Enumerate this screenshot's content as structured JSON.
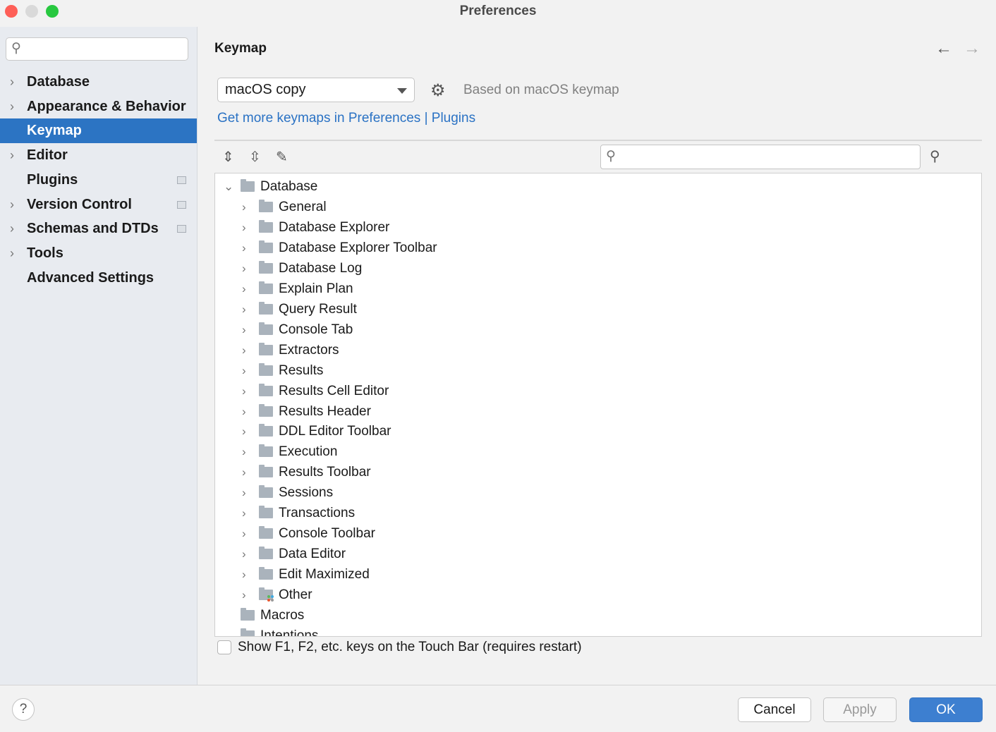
{
  "window": {
    "title": "Preferences"
  },
  "sidebar": {
    "search_placeholder": "",
    "items": [
      {
        "label": "Database",
        "expandable": true
      },
      {
        "label": "Appearance & Behavior",
        "expandable": true
      },
      {
        "label": "Keymap",
        "expandable": false,
        "selected": true
      },
      {
        "label": "Editor",
        "expandable": true
      },
      {
        "label": "Plugins",
        "expandable": false,
        "badge": true
      },
      {
        "label": "Version Control",
        "expandable": true,
        "badge": true
      },
      {
        "label": "Schemas and DTDs",
        "expandable": true,
        "badge": true
      },
      {
        "label": "Tools",
        "expandable": true
      },
      {
        "label": "Advanced Settings",
        "expandable": false
      }
    ]
  },
  "main": {
    "title": "Keymap",
    "keymap_select": "macOS copy",
    "based_on": "Based on macOS keymap",
    "more_link": "Get more keymaps in Preferences | Plugins",
    "tree": {
      "root": "Database",
      "children": [
        "General",
        "Database Explorer",
        "Database Explorer Toolbar",
        "Database Log",
        "Explain Plan",
        "Query Result",
        "Console Tab",
        "Extractors",
        "Results",
        "Results Cell Editor",
        "Results Header",
        "DDL Editor Toolbar",
        "Execution",
        "Results Toolbar",
        "Sessions",
        "Transactions",
        "Console Toolbar",
        "Data Editor",
        "Edit Maximized",
        "Other"
      ],
      "siblings": [
        "Macros",
        "Intentions"
      ]
    },
    "touchbar_checkbox": {
      "label": "Show F1, F2, etc. keys on the Touch Bar (requires restart)",
      "checked": false
    }
  },
  "footer": {
    "help": "?",
    "cancel": "Cancel",
    "apply": "Apply",
    "ok": "OK"
  },
  "colors": {
    "accent": "#2c74c3",
    "link": "#2a72c4"
  }
}
